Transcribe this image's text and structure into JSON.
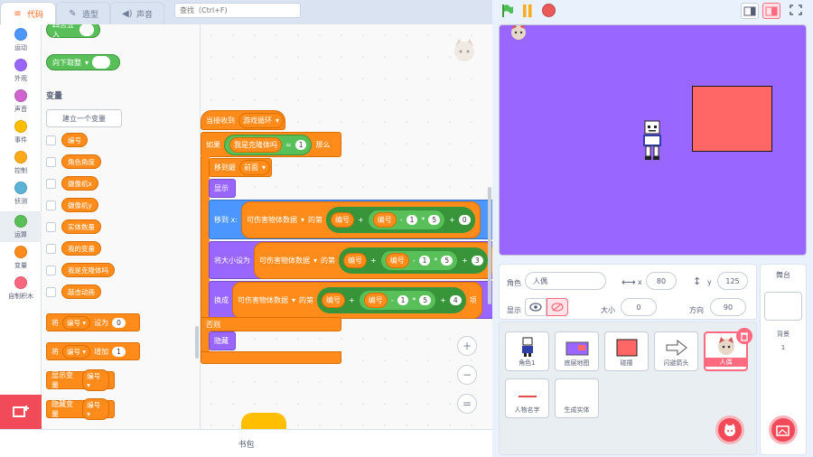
{
  "tabs": {
    "code": "代码",
    "costumes": "造型",
    "sounds": "声音"
  },
  "search": {
    "placeholder": "查找（Ctrl+F)"
  },
  "categories": [
    {
      "label": "运动",
      "color": "#4c97ff"
    },
    {
      "label": "外观",
      "color": "#9966ff"
    },
    {
      "label": "声音",
      "color": "#cf63cf"
    },
    {
      "label": "事件",
      "color": "#ffbf00"
    },
    {
      "label": "控制",
      "color": "#ffab19"
    },
    {
      "label": "侦测",
      "color": "#5cb1d6"
    },
    {
      "label": "运算",
      "color": "#59c059"
    },
    {
      "label": "变量",
      "color": "#ff8c1a"
    },
    {
      "label": "自制积木",
      "color": "#ff6680"
    }
  ],
  "palette": {
    "round_block": "四舍五入",
    "floor_block": "向下取整",
    "variables_heading": "变量",
    "make_variable": "建立一个变量",
    "variables": [
      "编号",
      "角色角度",
      "摄像机x",
      "摄像机y",
      "实体数量",
      "我的变量",
      "我是克隆体吗",
      "敲击动画"
    ],
    "set_block": {
      "label": "将",
      "var": "编号",
      "op": "设为",
      "value": "0"
    },
    "change_block": {
      "label": "将",
      "var": "编号",
      "op": "增加",
      "value": "1"
    },
    "show_var": {
      "label": "显示变量",
      "var": "编号"
    },
    "hide_var": {
      "label": "隐藏变量",
      "var": "编号"
    }
  },
  "script": {
    "hat": {
      "label": "当接收到",
      "value": "游戏循环"
    },
    "if": {
      "label": "如果",
      "var": "我是克隆体吗",
      "eq": "=",
      "value": "1",
      "then": "那么"
    },
    "goto": {
      "label": "移到最",
      "value": "前面"
    },
    "show": "显示",
    "move_x": {
      "label": "移到 x:",
      "list": "可伤害物体数据",
      "of": "的第",
      "var": "编号",
      "plus": "+",
      "var2": "编号",
      "minus": "-",
      "n1": "1",
      "mul": "*",
      "n2": "5",
      "plus2": "+",
      "n3": "0"
    },
    "size": {
      "label": "将大小设为",
      "list": "可伤害物体数据",
      "of": "的第",
      "var": "编号",
      "plus": "+",
      "var2": "编号",
      "minus": "-",
      "n1": "1",
      "mul": "*",
      "n2": "5",
      "plus2": "+",
      "n3": "3"
    },
    "costume": {
      "label": "换成",
      "list": "可伤害物体数据",
      "of": "的第",
      "var": "编号",
      "plus": "+",
      "var2": "编号",
      "minus": "-",
      "n1": "1",
      "mul": "*",
      "n2": "5",
      "plus2": "+",
      "n3": "4",
      "tail": "项"
    },
    "else": "否则",
    "hide": "隐藏"
  },
  "zoom": {
    "in": "+",
    "out": "−",
    "reset": "="
  },
  "backpack": "书包",
  "sprite_info": {
    "name_label": "角色",
    "name_value": "人偶",
    "x_label": "x",
    "x_value": "80",
    "y_label": "y",
    "y_value": "125",
    "show_label": "显示",
    "size_label": "大小",
    "size_value": "0",
    "dir_label": "方向",
    "dir_value": "90"
  },
  "sprites": [
    {
      "name": "角色1"
    },
    {
      "name": "底层地图"
    },
    {
      "name": "碰撞"
    },
    {
      "name": "闪避箭头"
    },
    {
      "name": "人偶",
      "selected": true
    },
    {
      "name": "人物名字"
    },
    {
      "name": "生成实体"
    }
  ],
  "stage_panel": {
    "title": "舞台",
    "backdrops_label": "背景",
    "backdrops_count": "1"
  },
  "colors": {
    "stage_bg": "#9966ff",
    "accent": "#ff6a20",
    "variable_orange": "#ff8c1a",
    "operator_green": "#59c059",
    "red_box": "#ff6666"
  }
}
